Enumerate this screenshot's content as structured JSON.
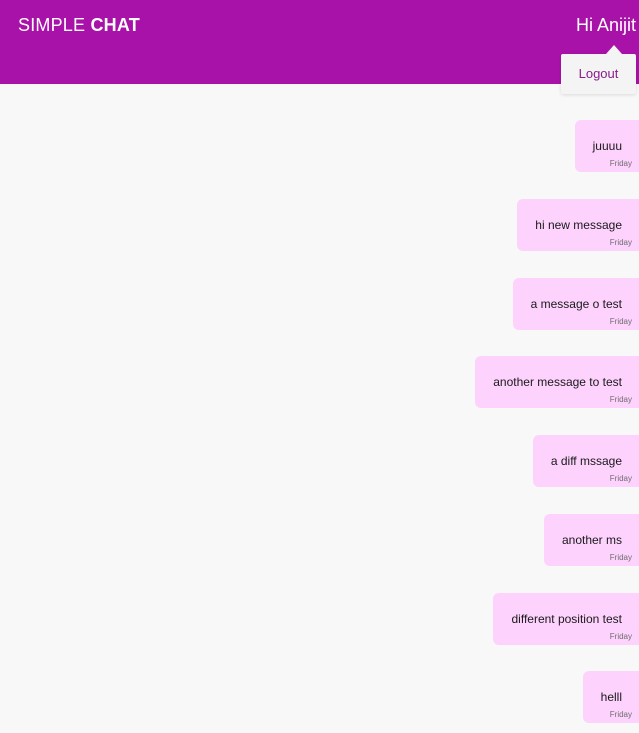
{
  "header": {
    "brand_light": "SIMPLE ",
    "brand_bold": "CHAT",
    "greeting": "Hi Anijit",
    "logout_label": "Logout",
    "background_color": "#a912a9"
  },
  "messages": [
    {
      "text": "juuuu",
      "time": "Friday"
    },
    {
      "text": "hi new message",
      "time": "Friday"
    },
    {
      "text": "a message o test",
      "time": "Friday"
    },
    {
      "text": "another message to test",
      "time": "Friday"
    },
    {
      "text": "a diff mssage",
      "time": "Friday"
    },
    {
      "text": "another ms",
      "time": "Friday"
    },
    {
      "text": "different position test",
      "time": "Friday"
    },
    {
      "text": "helll",
      "time": "Friday"
    }
  ],
  "colors": {
    "bubble": "#fdd2fd",
    "page_background": "#f8f8f8",
    "logout_text": "#8b1b8b"
  }
}
